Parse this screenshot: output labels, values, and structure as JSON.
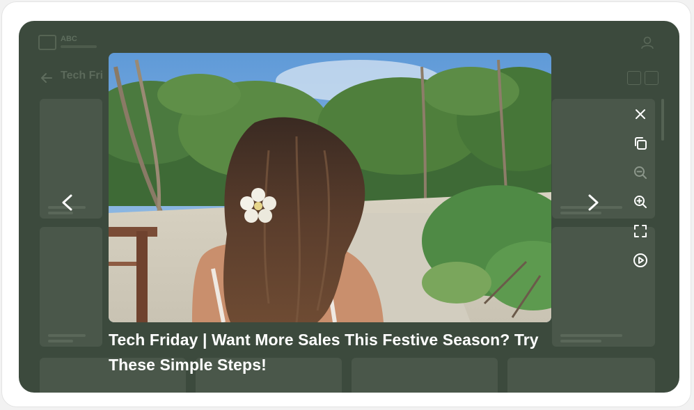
{
  "app": {
    "logo_text": "ABC",
    "page_title": "Tech Fri"
  },
  "lightbox": {
    "caption": "Tech Friday | Want More Sales This Festive Season? Try These Simple Steps!",
    "tools": [
      "close-icon",
      "copy-icon",
      "zoom-out-icon",
      "zoom-in-icon",
      "fullscreen-icon",
      "play-slideshow-icon"
    ],
    "nav": [
      "chevron-left-icon",
      "chevron-right-icon"
    ]
  },
  "colors": {
    "overlay": "#3c4a3d",
    "caption_text": "#ffffff"
  }
}
